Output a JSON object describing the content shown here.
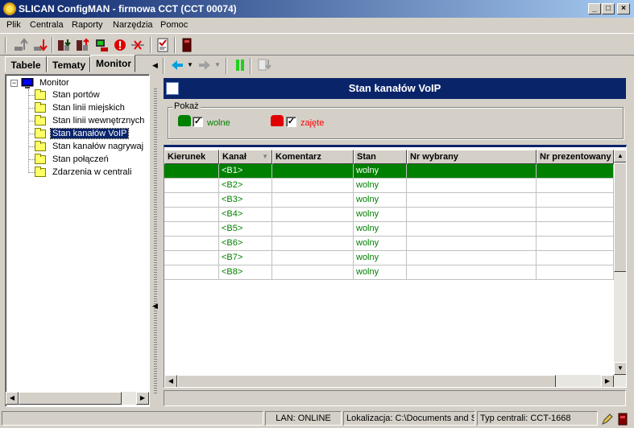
{
  "window": {
    "title": "SLICAN ConfigMAN - firmowa CCT (CCT 00074)",
    "controls": {
      "minimize": "_",
      "maximize": "□",
      "close": "×"
    }
  },
  "menu": [
    "Plik",
    "Centrala",
    "Raporty",
    "Narzędzia",
    "Pomoc"
  ],
  "toolbar": {
    "icons": [
      "upload-icon",
      "download-icon",
      "send-config-icon",
      "receive-config-icon",
      "connect-icon",
      "stop-icon",
      "disconnect-icon",
      "edit-report-icon",
      "device-icon"
    ]
  },
  "tabs": [
    {
      "label": "Tabele",
      "active": false
    },
    {
      "label": "Tematy",
      "active": false
    },
    {
      "label": "Monitor",
      "active": true
    }
  ],
  "tree": {
    "root": "Monitor",
    "root_toggle": "−",
    "items": [
      {
        "label": "Stan portów",
        "selected": false
      },
      {
        "label": "Stan linii miejskich",
        "selected": false
      },
      {
        "label": "Stan linii wewnętrznych",
        "selected": false
      },
      {
        "label": "Stan kanałów VoIP",
        "selected": true
      },
      {
        "label": "Stan kanałów nagrywaj",
        "selected": false
      },
      {
        "label": "Stan połączeń",
        "selected": false
      },
      {
        "label": "Zdarzenia w centrali",
        "selected": false
      }
    ]
  },
  "panel": {
    "title": "Stan kanałów VoIP",
    "pokaz": {
      "legend": "Pokaż",
      "free": {
        "label": "wolne",
        "checked": "✓",
        "color": "#008000"
      },
      "busy": {
        "label": "zajęte",
        "checked": "✓",
        "color": "#ff0000"
      }
    }
  },
  "grid": {
    "columns": [
      "Kierunek",
      "Kanał",
      "Komentarz",
      "Stan",
      "Nr wybrany",
      "Nr prezentowany"
    ],
    "sort_indicator": "▼",
    "rows": [
      {
        "kierunek": "",
        "kanal": "<B1>",
        "komentarz": "",
        "stan": "wolny",
        "nr_wybrany": "",
        "nr_prezentowany": "",
        "selected": true
      },
      {
        "kierunek": "",
        "kanal": "<B2>",
        "komentarz": "",
        "stan": "wolny",
        "nr_wybrany": "",
        "nr_prezentowany": "",
        "selected": false
      },
      {
        "kierunek": "",
        "kanal": "<B3>",
        "komentarz": "",
        "stan": "wolny",
        "nr_wybrany": "",
        "nr_prezentowany": "",
        "selected": false
      },
      {
        "kierunek": "",
        "kanal": "<B4>",
        "komentarz": "",
        "stan": "wolny",
        "nr_wybrany": "",
        "nr_prezentowany": "",
        "selected": false
      },
      {
        "kierunek": "",
        "kanal": "<B5>",
        "komentarz": "",
        "stan": "wolny",
        "nr_wybrany": "",
        "nr_prezentowany": "",
        "selected": false
      },
      {
        "kierunek": "",
        "kanal": "<B6>",
        "komentarz": "",
        "stan": "wolny",
        "nr_wybrany": "",
        "nr_prezentowany": "",
        "selected": false
      },
      {
        "kierunek": "",
        "kanal": "<B7>",
        "komentarz": "",
        "stan": "wolny",
        "nr_wybrany": "",
        "nr_prezentowany": "",
        "selected": false
      },
      {
        "kierunek": "",
        "kanal": "<B8>",
        "komentarz": "",
        "stan": "wolny",
        "nr_wybrany": "",
        "nr_prezentowany": "",
        "selected": false
      }
    ]
  },
  "status": {
    "lan": "LAN: ONLINE",
    "location": "Lokalizacja: C:\\Documents and Se",
    "type": "Typ centrali: CCT-1668"
  },
  "colors": {
    "titlebar_start": "#0a246a",
    "titlebar_end": "#a6caf0",
    "selection_row": "#008000",
    "selected_tree": "#0a246a"
  }
}
